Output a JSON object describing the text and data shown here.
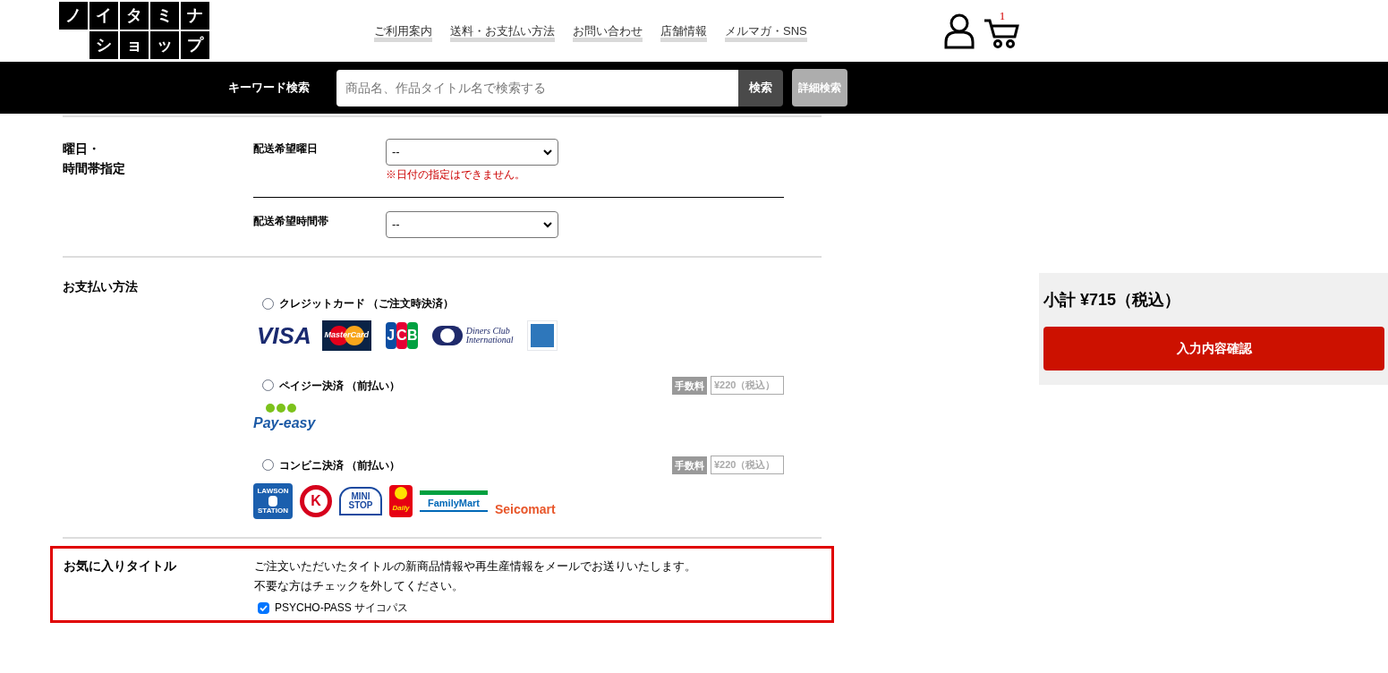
{
  "logo": {
    "top": [
      "ノ",
      "イ",
      "タ",
      "ミ",
      "ナ"
    ],
    "bottom": [
      "シ",
      "ョ",
      "ッ",
      "プ"
    ]
  },
  "nav": [
    "ご利用案内",
    "送料・お支払い方法",
    "お問い合わせ",
    "店舗情報",
    "メルマガ・SNS"
  ],
  "cart": {
    "count": "1"
  },
  "search": {
    "label": "キーワード検索",
    "placeholder": "商品名、作品タイトル名で検索する",
    "button": "検索",
    "advanced": "詳細検索"
  },
  "delivery": {
    "label": [
      "曜日・",
      "時間帯指定"
    ],
    "rows": [
      {
        "label": "配送希望曜日",
        "value": "--",
        "note": "※日付の指定はできません。"
      },
      {
        "label": "配送希望時間帯",
        "value": "--"
      }
    ]
  },
  "payment": {
    "label": "お支払い方法",
    "options": [
      {
        "label": "クレジットカード （ご注文時決済）",
        "selected": false,
        "logos": [
          {
            "kind": "visa",
            "text": "VISA"
          },
          {
            "kind": "mastercard",
            "text": "MasterCard"
          },
          {
            "kind": "jcb",
            "text": "JCB"
          },
          {
            "kind": "diners",
            "text": "Diners Club",
            "text2": "International"
          },
          {
            "kind": "amex"
          }
        ]
      },
      {
        "label": "ペイジー決済 （前払い）",
        "selected": false,
        "fee": {
          "tag": "手数料",
          "amount": "¥220（税込）"
        },
        "logos": [
          {
            "kind": "payeasy",
            "text": "Pay-easy"
          }
        ]
      },
      {
        "label": "コンビニ決済 （前払い）",
        "selected": false,
        "fee": {
          "tag": "手数料",
          "amount": "¥220（税込）"
        },
        "logos": [
          {
            "kind": "lawson",
            "text": "LAWSON",
            "text2": "STATION"
          },
          {
            "kind": "circlek",
            "text": "K"
          },
          {
            "kind": "ministop",
            "text": "MINI",
            "text2": "STOP"
          },
          {
            "kind": "daily",
            "text": "Daily"
          },
          {
            "kind": "familymart",
            "text": "FamilyMart"
          },
          {
            "kind": "seicomart",
            "text": "Seicomart"
          }
        ]
      }
    ]
  },
  "favorites": {
    "label": "お気に入りタイトル",
    "lines": [
      "ご注文いただいたタイトルの新商品情報や再生産情報をメールでお送りいたします。",
      "不要な方はチェックを外してください。"
    ],
    "items": [
      {
        "label": "PSYCHO-PASS サイコパス",
        "checked": true
      }
    ]
  },
  "summary": {
    "subtotal": "小計 ¥715（税込）",
    "button": "入力内容確認"
  }
}
